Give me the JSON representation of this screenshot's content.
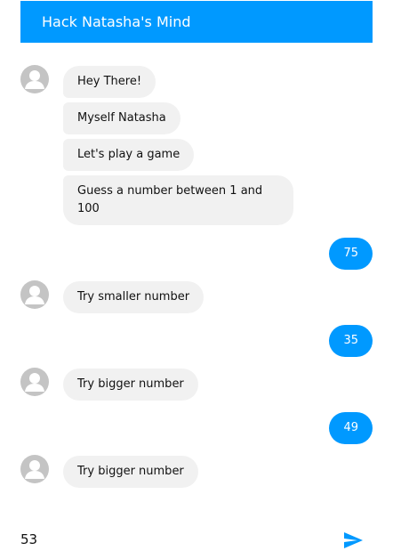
{
  "header": {
    "title": "Hack Natasha's Mind"
  },
  "messages": {
    "m1": "Hey There!",
    "m2": "Myself Natasha",
    "m3": "Let's play a game",
    "m4": "Guess a number between 1 and 100",
    "u1": "75",
    "m5": "Try smaller number",
    "u2": "35",
    "m6": "Try bigger number",
    "u3": "49",
    "m7": "Try bigger number"
  },
  "composer": {
    "value": "53"
  },
  "icons": {
    "avatar": "person-icon",
    "send": "send-icon"
  },
  "colors": {
    "accent": "#0099ff",
    "incoming_bubble": "#f1f1f1",
    "avatar_bg": "#c4c4c4"
  }
}
